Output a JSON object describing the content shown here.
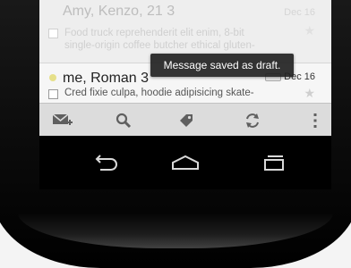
{
  "emails": [
    {
      "sender": "Amy, Kenzo, 21 3",
      "date": "Dec 16",
      "snippet_line1": "Food truck reprehenderit elit enim, 8-bit",
      "snippet_line2": "single-origin coffee butcher ethical gluten-"
    },
    {
      "sender": "me, Roman 3",
      "date": "Dec 16",
      "snippet": "Cred fixie culpa, hoodie adipisicing skate-"
    }
  ],
  "toast": {
    "text": "Message saved as draft."
  },
  "action_bar": {
    "items": [
      "compose-icon",
      "search-icon",
      "label-icon",
      "refresh-icon",
      "overflow-menu-icon"
    ]
  },
  "nav_bar": {
    "items": [
      "back-icon",
      "home-icon",
      "recent-apps-icon"
    ]
  },
  "colors": {
    "action_bar_bg": "#dcdcdc",
    "toast_bg": "#222222",
    "nav_bg": "#000000",
    "icon_gray": "#5f5f5f"
  }
}
